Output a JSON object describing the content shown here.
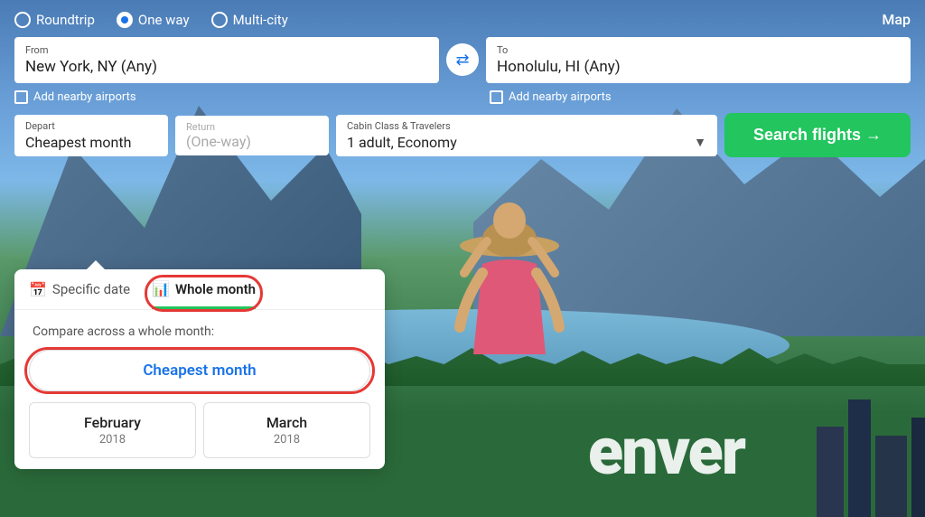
{
  "trip_types": {
    "roundtrip": "Roundtrip",
    "one_way": "One way",
    "multi_city": "Multi-city",
    "selected": "one_way"
  },
  "map_label": "Map",
  "from_label": "From",
  "to_label": "To",
  "from_value": "New York, NY (Any)",
  "to_value": "Honolulu, HI (Any)",
  "nearby_label": "Add nearby airports",
  "depart_label": "Depart",
  "return_label": "Return",
  "depart_value": "Cheapest month",
  "return_value": "(One-way)",
  "cabin_label": "Cabin Class & Travelers",
  "cabin_value": "1 adult, Economy",
  "search_label": "Search flights →",
  "dropdown": {
    "specific_date_tab": "Specific date",
    "whole_month_tab": "Whole month",
    "compare_text": "Compare across a whole month:",
    "cheapest_month_label": "Cheapest month",
    "months": [
      {
        "name": "February",
        "year": "2018"
      },
      {
        "name": "March",
        "year": "2018"
      }
    ]
  },
  "city_label": "enver"
}
